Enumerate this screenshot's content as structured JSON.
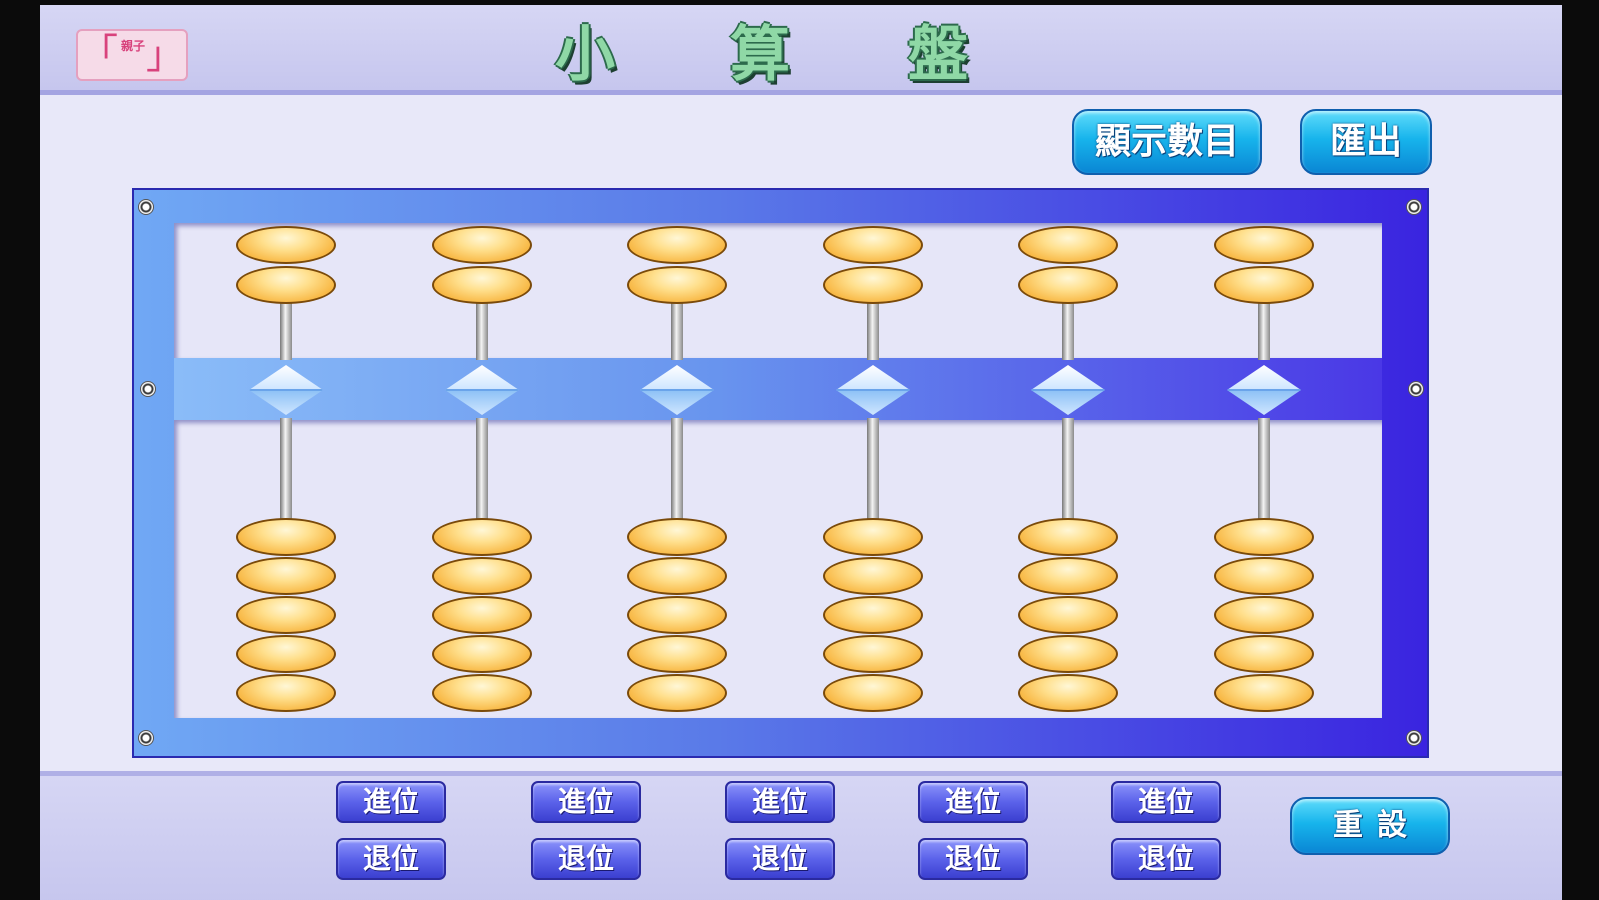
{
  "title_bar": {
    "logo_text": "親子",
    "title_chars": [
      "小",
      "算",
      "盤"
    ]
  },
  "toolbar": {
    "show_number_label": "顯示數目",
    "exit_label": "匯出"
  },
  "abacus": {
    "rods": 6,
    "upper_beads_per_rod": 2,
    "lower_beads_per_rod": 5,
    "bead_color": "#f7b23a",
    "frame_color": "#5a7ae8"
  },
  "controls": {
    "carry_label": "進位",
    "borrow_label": "退位",
    "carry_buttons": [
      "進位",
      "進位",
      "進位",
      "進位",
      "進位"
    ],
    "borrow_buttons": [
      "退位",
      "退位",
      "退位",
      "退位",
      "退位"
    ],
    "reset_label": "重設"
  }
}
